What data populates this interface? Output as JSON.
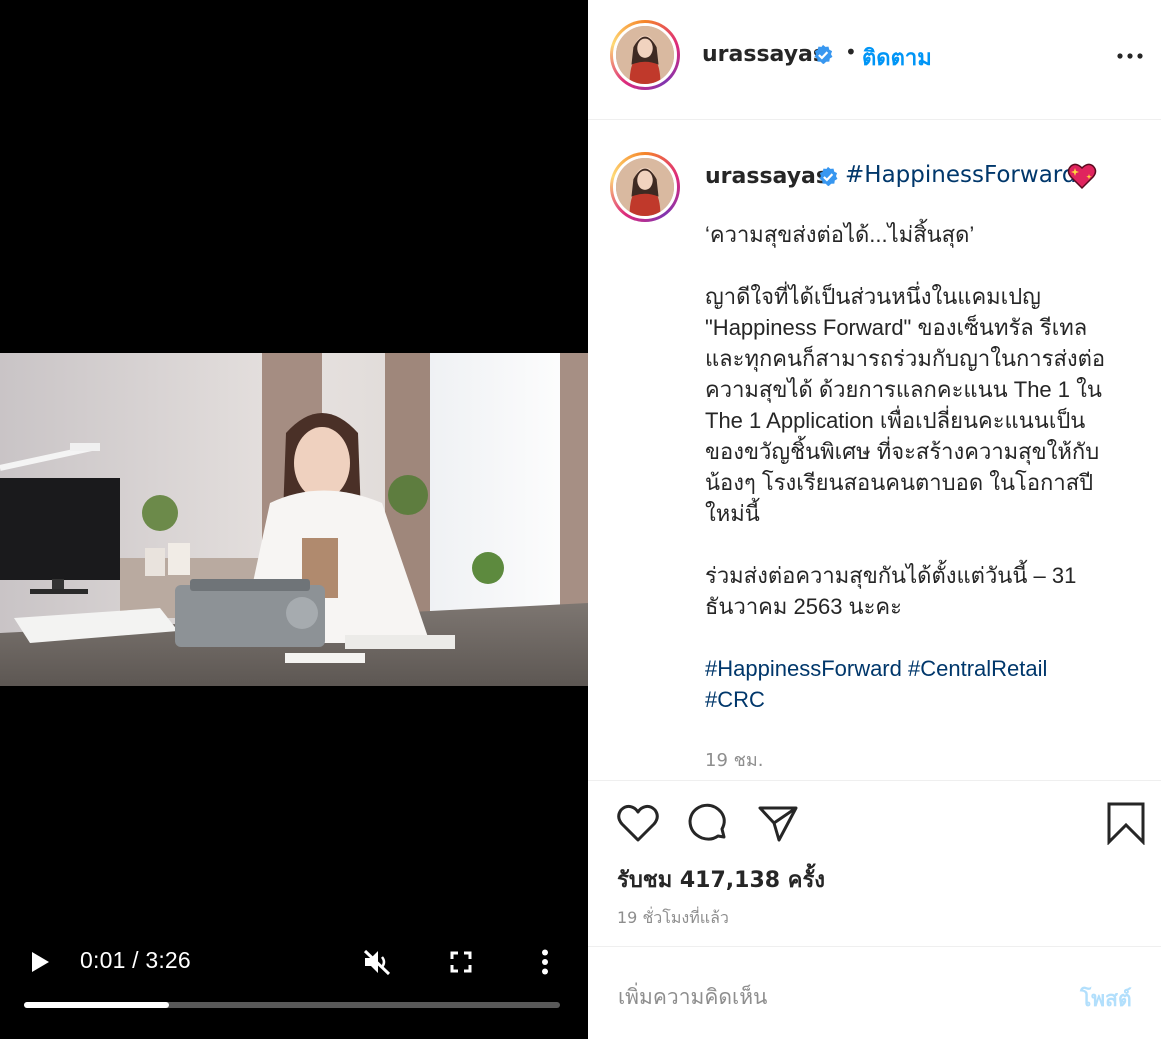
{
  "video": {
    "time_display": "0:01 / 3:26",
    "progress": 0.27,
    "muted": true
  },
  "header": {
    "username": "urassayas",
    "separator": "•",
    "follow_label": "ติดตาม"
  },
  "caption": {
    "username": "urassayas",
    "first_hashtag": "#HappinessForward",
    "paragraphs": [
      "‘ความสุขส่งต่อได้...ไม่สิ้นสุด’",
      "ญาดีใจที่ได้เป็นส่วนหนึ่งในแคมเปญ\n\"Happiness Forward\" ของเซ็นทรัล รีเทล\nและทุกคนก็สามารถร่วมกับญาในการส่งต่อ\nความสุขได้ ด้วยการแลกคะแนน The 1 ใน\nThe 1 Application เพื่อเปลี่ยนคะแนนเป็น\nของขวัญชิ้นพิเศษ ที่จะสร้างความสุขให้กับ\nน้องๆ โรงเรียนสอนคนตาบอด ในโอกาสปี\nใหม่นี้",
      "ร่วมส่งต่อความสุขกันได้ตั้งแต่วันนี้ – 31\nธันวาคม 2563 นะคะ"
    ],
    "hashtags": [
      "#HappinessForward",
      "#CentralRetail",
      "#CRC"
    ],
    "time": "19 ชม."
  },
  "stats": {
    "views": "รับชม 417,138 ครั้ง",
    "posted_ago": "19 ชั่วโมงที่แล้ว"
  },
  "comment": {
    "placeholder": "เพิ่มความคิดเห็น",
    "post_label": "โพสต์"
  },
  "colors": {
    "link": "#00376b",
    "follow": "#0095f6",
    "verified": "#3897f0",
    "post_disabled": "#b2dffc",
    "muted_text": "#8e8e8e"
  },
  "icons": {
    "play": "play-icon",
    "mute": "volume-muted-icon",
    "fullscreen": "fullscreen-icon",
    "more": "more-vertical-icon",
    "options": "more-horizontal-icon",
    "like": "heart-icon",
    "comment": "comment-icon",
    "share": "paper-plane-icon",
    "save": "bookmark-icon",
    "verified": "verified-badge-icon"
  }
}
